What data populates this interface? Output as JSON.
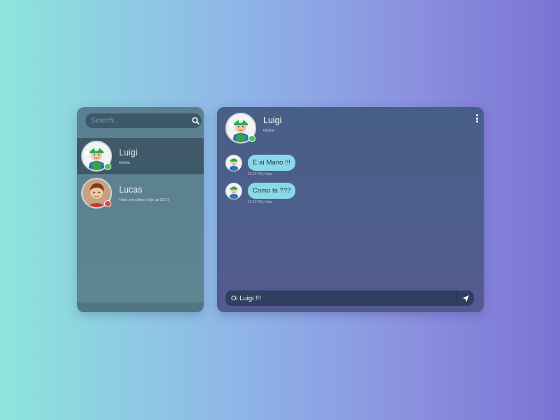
{
  "sidebar": {
    "search": {
      "placeholder": "Search...",
      "value": ""
    },
    "contacts": [
      {
        "name": "Luigi",
        "status": "Online",
        "presence_color": "#44c45a",
        "selected": true
      },
      {
        "name": "Lucas",
        "status": "Visto por ultimo hoje as 20:17",
        "presence_color": "#e0463c",
        "selected": false
      }
    ]
  },
  "chat": {
    "contact_name": "Luigi",
    "contact_status": "Online",
    "presence_color": "#44c45a",
    "messages": [
      {
        "text": "E aí Mario !!!",
        "time": "22:14 PM, Hoje"
      },
      {
        "text": "Como tá ???",
        "time": "22:14 PM, Hoje"
      }
    ],
    "composer": {
      "value": "Oi Luigi !!!"
    }
  },
  "colors": {
    "bubble": "#8bd8e6",
    "online": "#44c45a",
    "offline": "#e0463c"
  },
  "icons": {
    "search": "search-icon",
    "menu": "more-vertical-icon",
    "send": "send-icon"
  }
}
